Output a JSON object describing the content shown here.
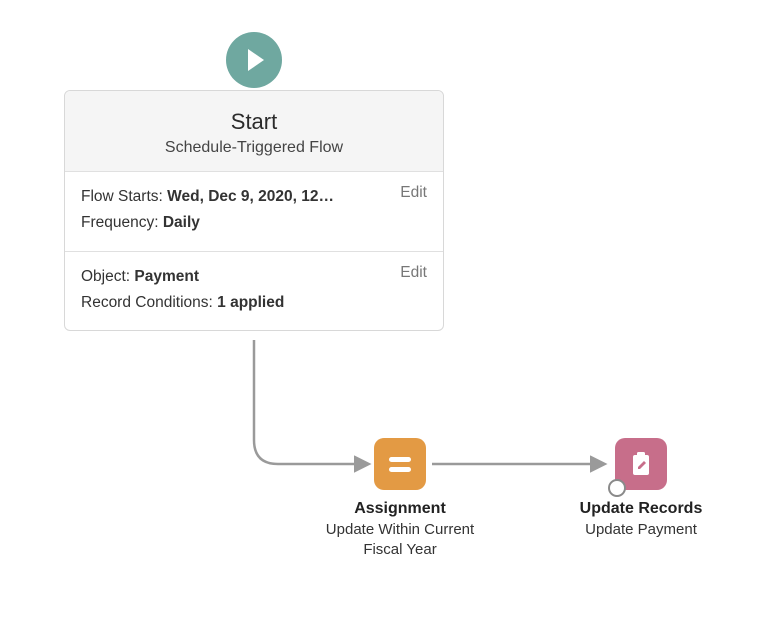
{
  "start": {
    "title": "Start",
    "subtitle": "Schedule-Triggered Flow",
    "schedule": {
      "flow_starts_label": "Flow Starts:",
      "flow_starts_value": "Wed, Dec 9, 2020, 12…",
      "frequency_label": "Frequency:",
      "frequency_value": "Daily",
      "edit_label": "Edit"
    },
    "object": {
      "object_label": "Object:",
      "object_value": "Payment",
      "conditions_label": "Record Conditions:",
      "conditions_value": "1 applied",
      "edit_label": "Edit"
    }
  },
  "nodes": {
    "assignment": {
      "title": "Assignment",
      "subtitle": "Update Within Current Fiscal Year"
    },
    "update_records": {
      "title": "Update Records",
      "subtitle": "Update Payment"
    }
  }
}
